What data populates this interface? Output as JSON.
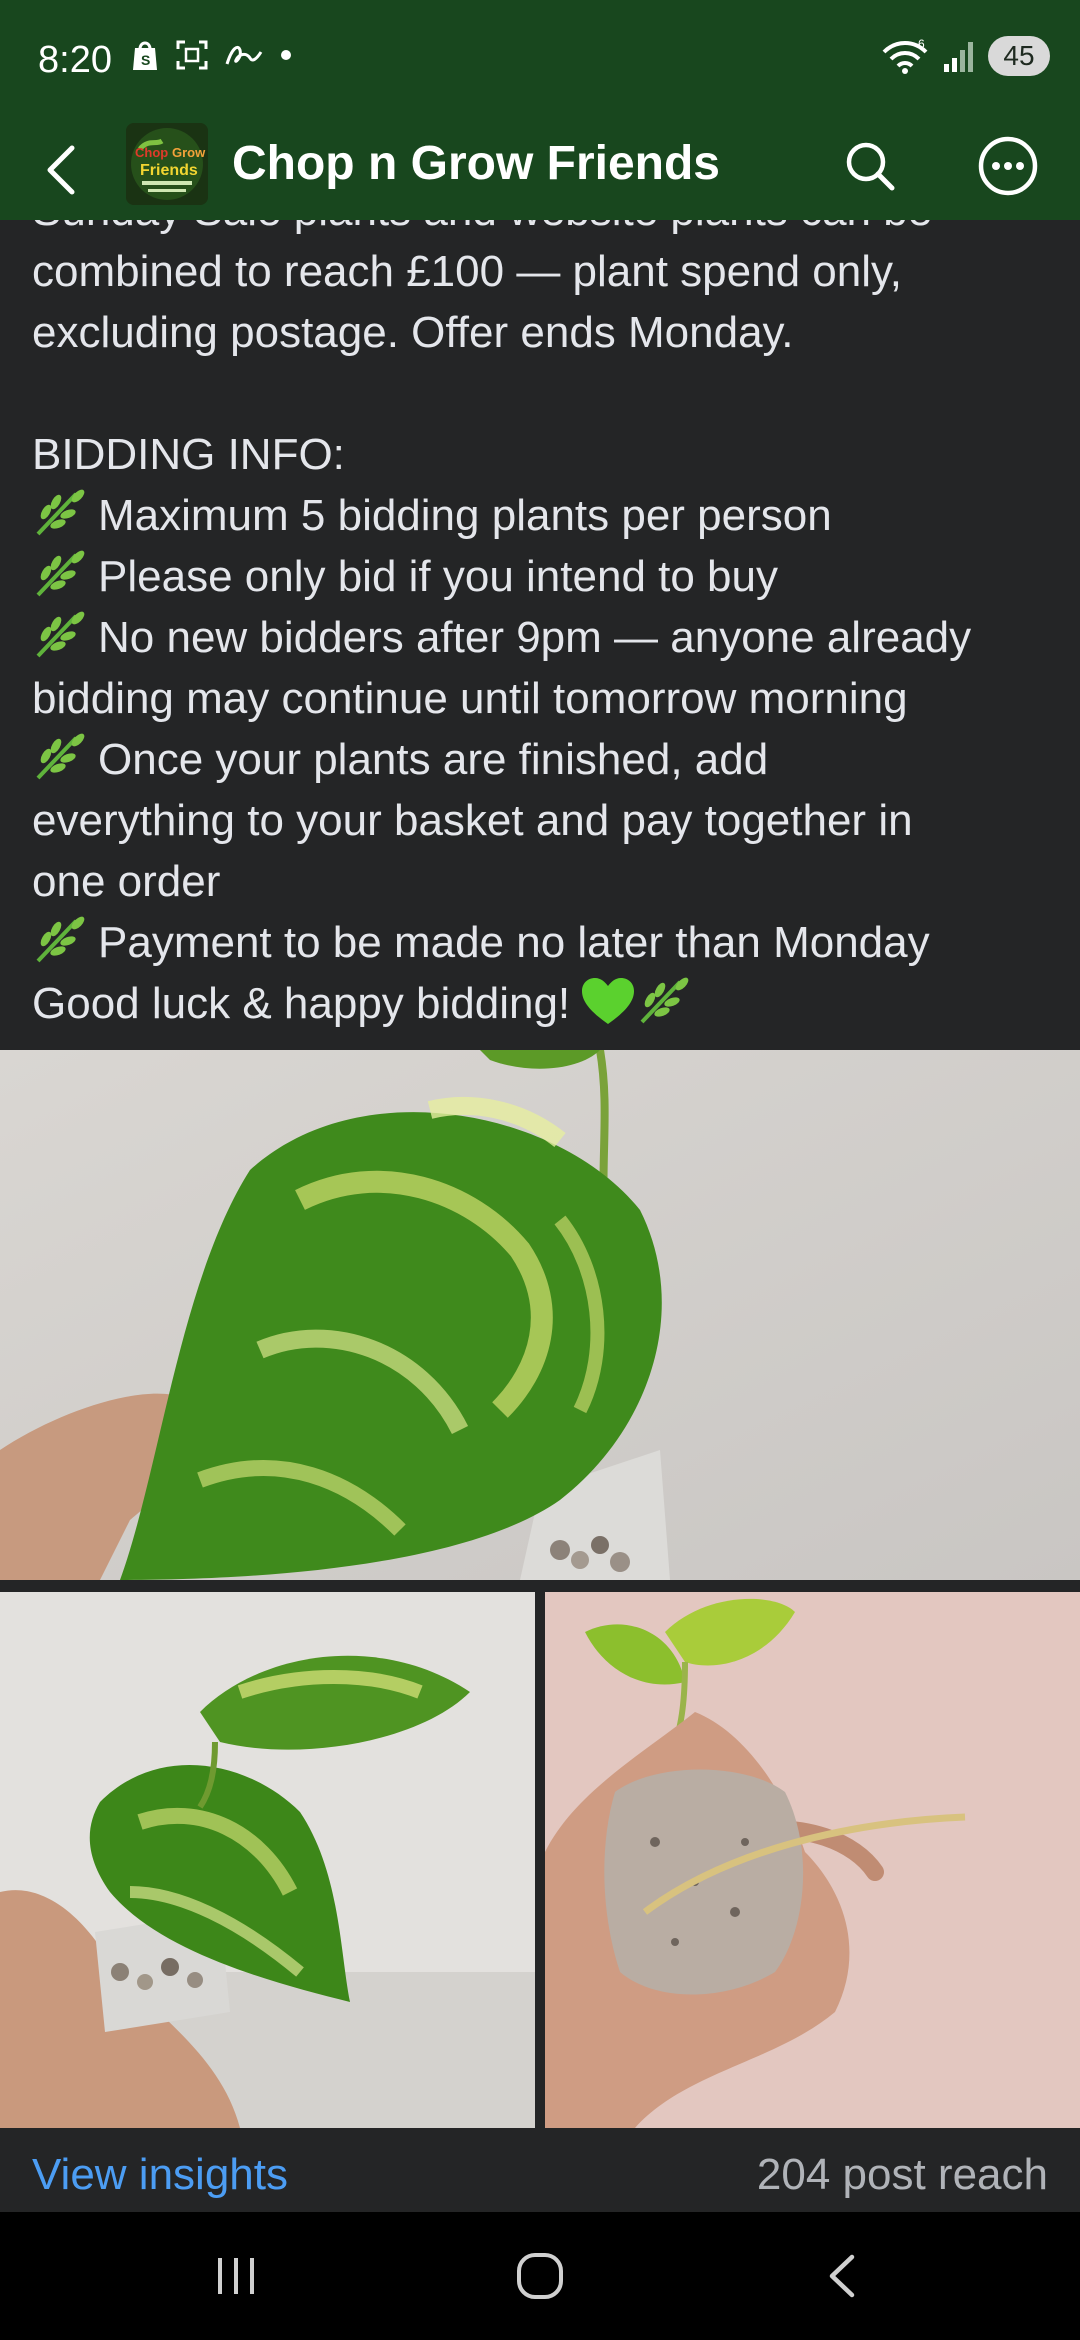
{
  "status_bar": {
    "time": "8:20",
    "battery": "45",
    "icons": [
      "shop-icon",
      "screenshot-icon",
      "signature-icon",
      "dot-icon",
      "wifi-icon",
      "signal-icon",
      "battery-icon"
    ]
  },
  "app_bar": {
    "title": "Chop n Grow Friends",
    "back_icon": "back-arrow-icon",
    "search_icon": "search-icon",
    "more_icon": "more-icon"
  },
  "post": {
    "cut_line": "Sunday Sale plants and website plants can be",
    "offer_lines": [
      "combined to reach £100 — plant spend only,",
      "excluding postage. Offer ends Monday."
    ],
    "bidding_heading": "BIDDING INFO:",
    "bullet_1": "Maximum 5 bidding plants per person",
    "bullet_2": "Please only bid if you intend to buy",
    "bullet_3_line1": "No new bidders after 9pm — anyone already",
    "bullet_3_line2": "bidding may continue until tomorrow morning",
    "bullet_4_line1": "Once your plants are finished, add",
    "bullet_4_line2": "everything to your basket and pay together in",
    "bullet_4_line3": "one order",
    "bullet_5": "Payment to be made no later than Monday",
    "closing": "Good luck & happy bidding!",
    "bullet_icon": "herb-icon",
    "heart_icon": "green-heart-icon"
  },
  "footer": {
    "view_insights": "View insights",
    "post_reach": "204 post reach"
  },
  "colors": {
    "header_bg": "#18471e",
    "page_bg": "#242526",
    "text": "#e4e6eb",
    "link": "#4c9df3",
    "muted": "#b0b3b8"
  }
}
